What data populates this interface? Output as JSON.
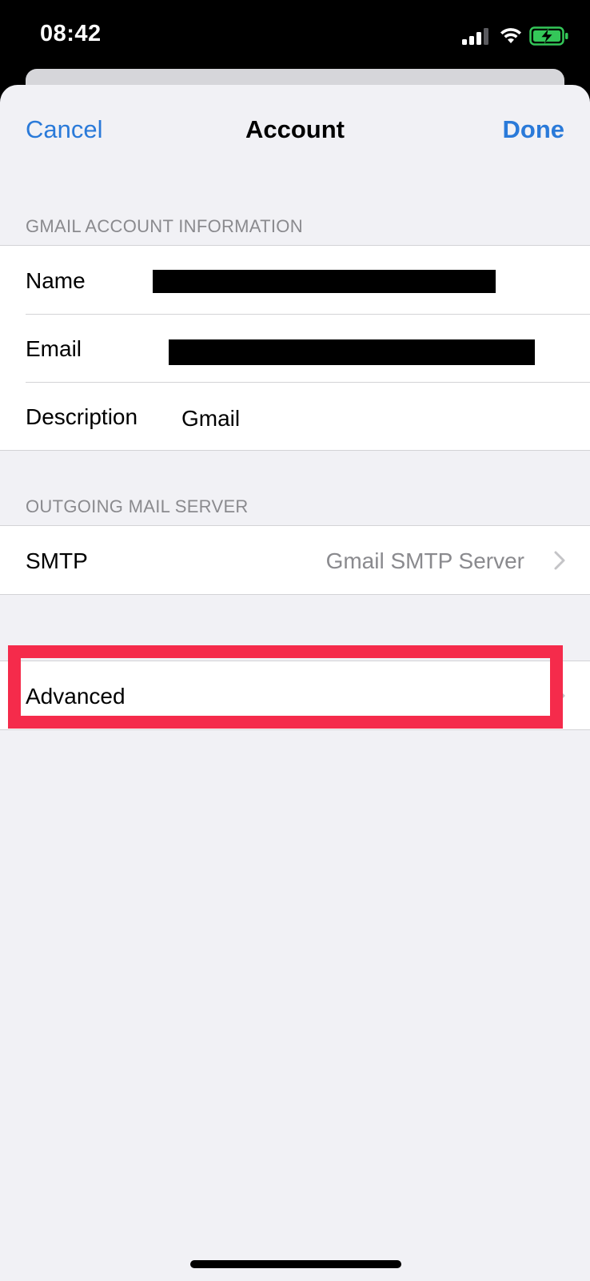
{
  "status_bar": {
    "time": "08:42",
    "icons": [
      "signal-icon",
      "wifi-icon",
      "battery-charging-icon"
    ],
    "battery_color": "#34c759"
  },
  "nav": {
    "cancel_label": "Cancel",
    "title": "Account",
    "done_label": "Done",
    "accent_color": "#2a7ad9"
  },
  "account_section": {
    "header": "GMAIL ACCOUNT INFORMATION",
    "rows": [
      {
        "label": "Name",
        "value": "",
        "redacted": true
      },
      {
        "label": "Email",
        "value": "",
        "redacted": true
      },
      {
        "label": "Description",
        "value": "Gmail",
        "redacted": false
      }
    ]
  },
  "outgoing_section": {
    "header": "OUTGOING MAIL SERVER",
    "smtp_label": "SMTP",
    "smtp_value": "Gmail SMTP Server"
  },
  "advanced": {
    "label": "Advanced",
    "highlight_color": "#f52b4b"
  }
}
